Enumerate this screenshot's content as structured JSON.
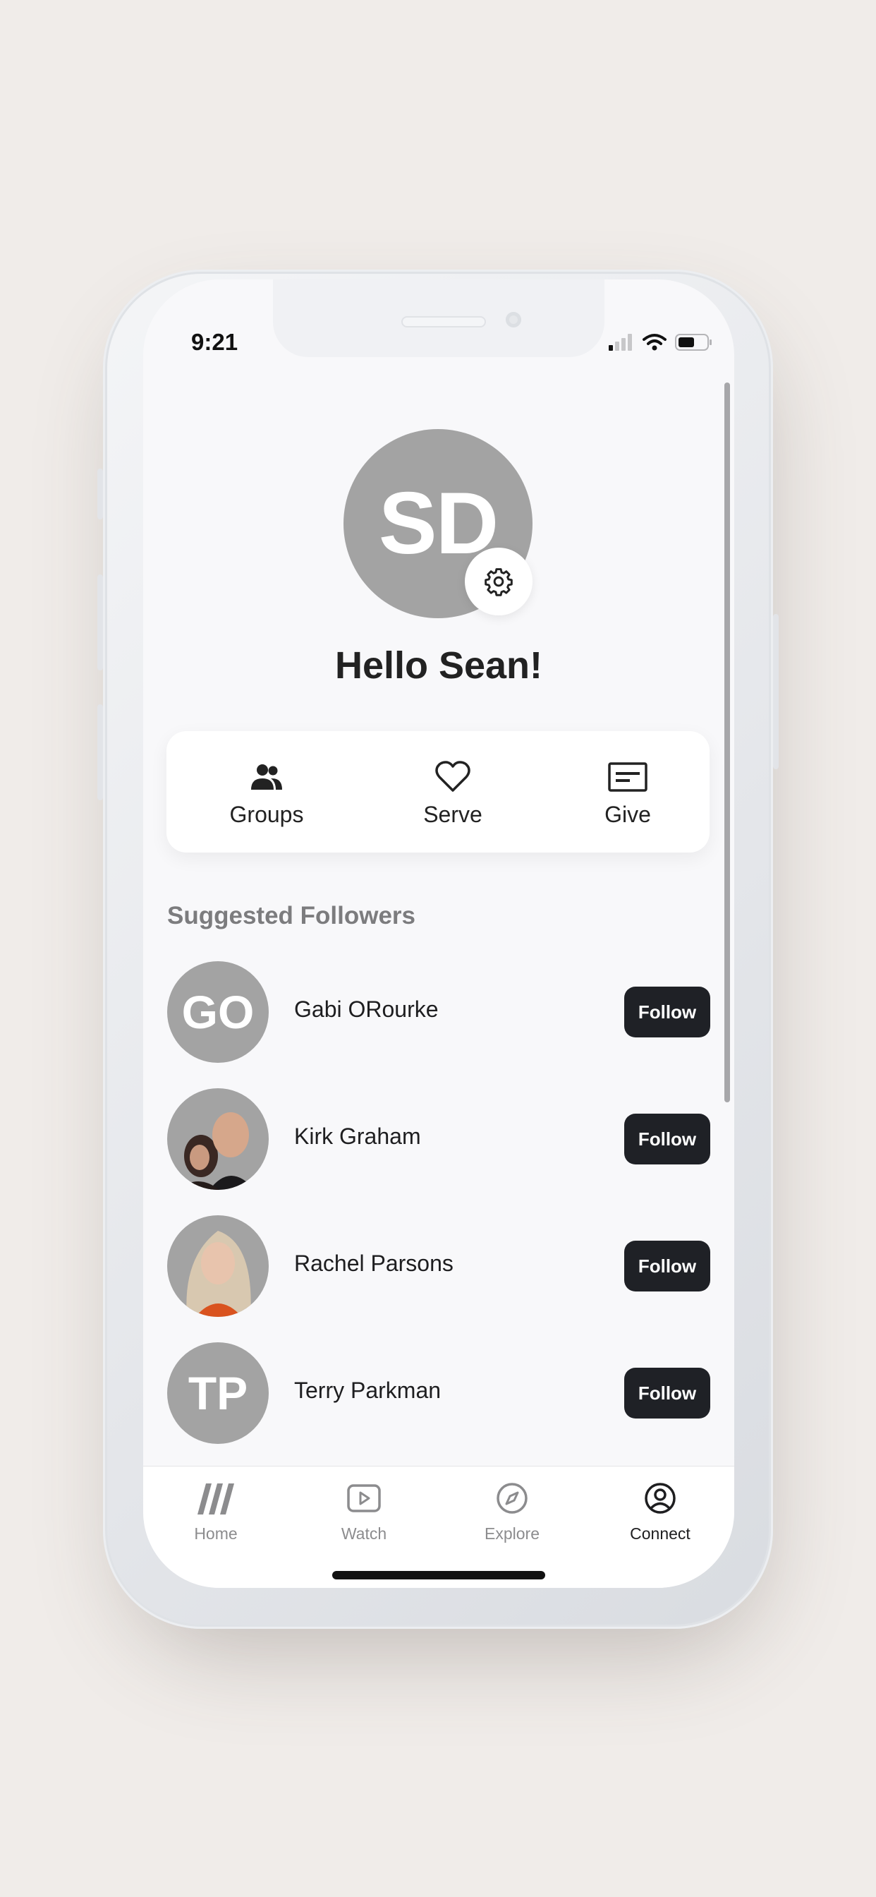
{
  "status_bar": {
    "time": "9:21"
  },
  "profile": {
    "initials": "SD",
    "greeting": "Hello Sean!"
  },
  "actions": [
    {
      "label": "Groups",
      "icon": "people-icon"
    },
    {
      "label": "Serve",
      "icon": "heart-icon"
    },
    {
      "label": "Give",
      "icon": "card-icon"
    }
  ],
  "suggested": {
    "title": "Suggested Followers",
    "follow_label": "Follow",
    "people": [
      {
        "name": "Gabi ORourke",
        "initials": "GO"
      },
      {
        "name": "Kirk Graham",
        "initials": ""
      },
      {
        "name": "Rachel Parsons",
        "initials": ""
      },
      {
        "name": "Terry Parkman",
        "initials": "TP"
      }
    ]
  },
  "tabs": [
    {
      "label": "Home",
      "icon": "logo-icon"
    },
    {
      "label": "Watch",
      "icon": "play-icon"
    },
    {
      "label": "Explore",
      "icon": "compass-icon"
    },
    {
      "label": "Connect",
      "icon": "user-circle-icon",
      "active": true
    }
  ],
  "colors": {
    "background": "#f0ece9",
    "screen": "#f8f8fa",
    "avatar_gray": "#a3a3a3",
    "follow_button": "#1f2126",
    "section_title": "#7c7c7e"
  }
}
